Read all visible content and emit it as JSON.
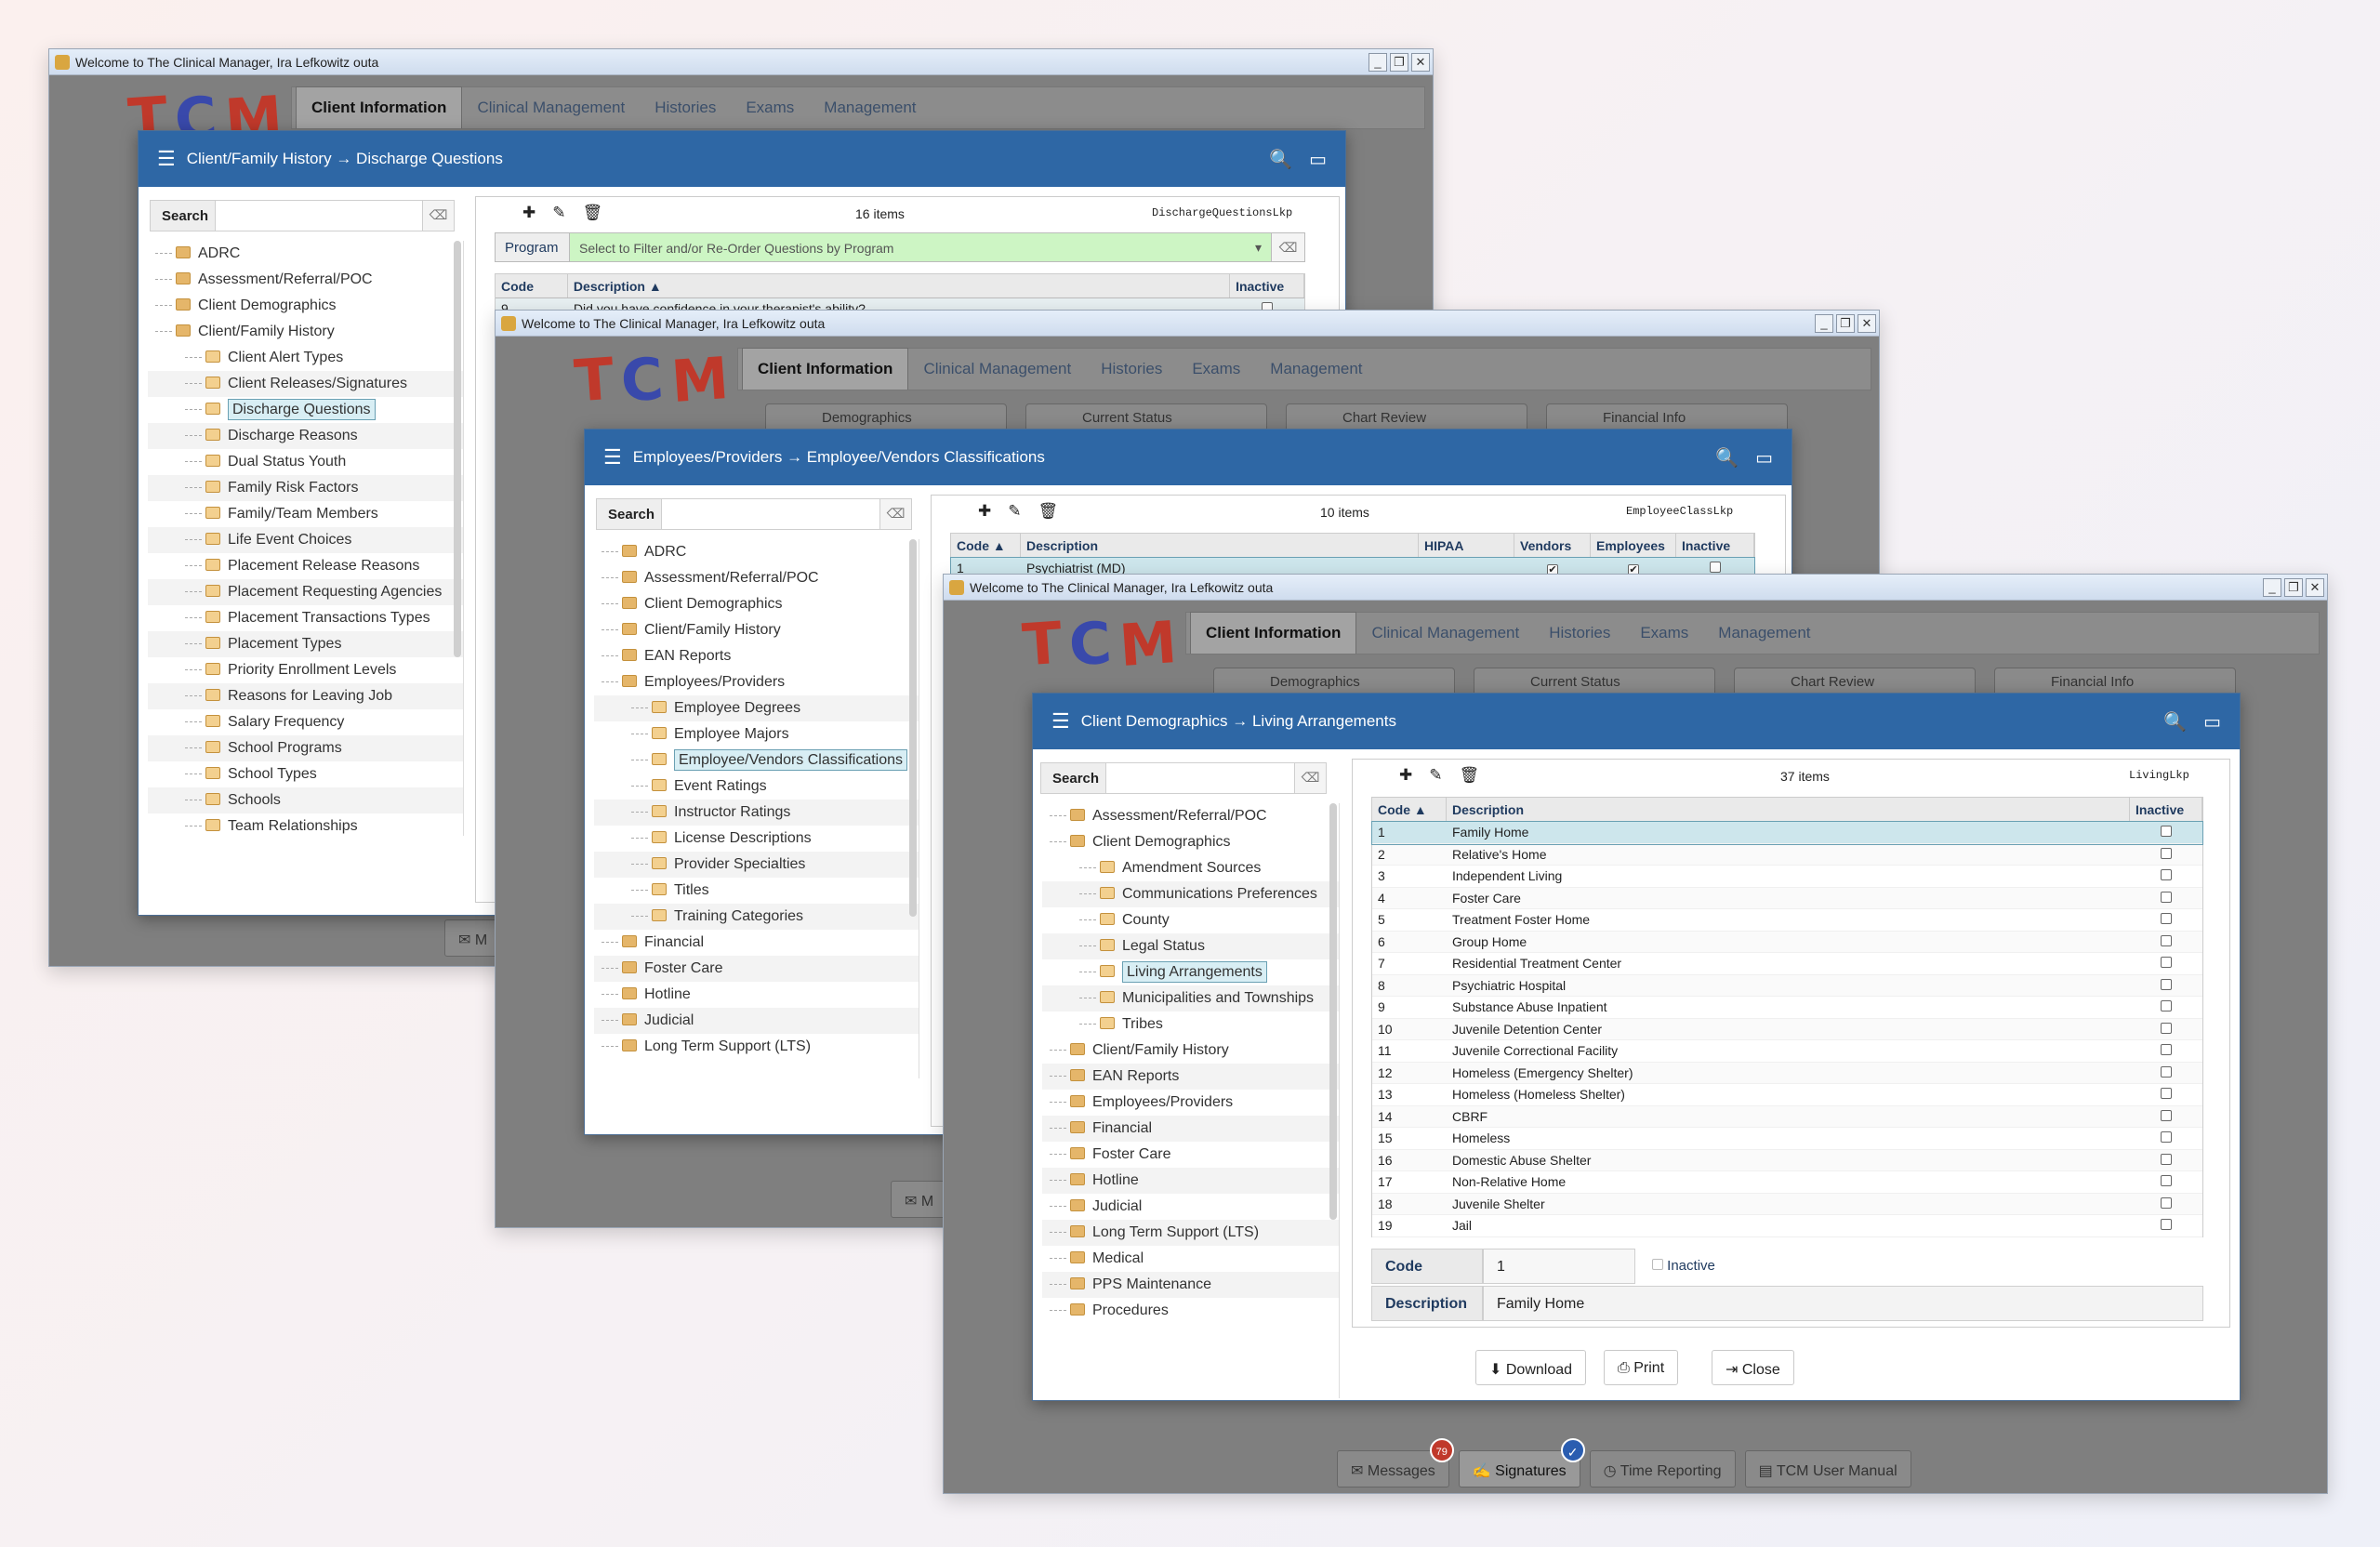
{
  "window_title": "Welcome to The Clinical Manager, Ira Lefkowitz outa",
  "logo": [
    "T",
    "C",
    "M"
  ],
  "colors": {
    "header_blue": "#2e67a5",
    "logo_t": "#c0392b",
    "logo_c": "#3949ab",
    "logo_m": "#c0392b",
    "filter_green": "#cdf5c4",
    "selection": "#cde6ec"
  },
  "nav_tabs": [
    "Client Information",
    "Clinical Management",
    "Histories",
    "Exams",
    "Management"
  ],
  "sub_tabs": [
    "Demographics",
    "Current Status",
    "Chart Review",
    "Financial Info"
  ],
  "bottom_bar": {
    "messages": "Messages",
    "messages_count": "79",
    "signatures": "Signatures",
    "time_reporting": "Time Reporting",
    "manual": "TCM User Manual",
    "short_msg": "M"
  },
  "search_label": "Search",
  "w1": {
    "modal_title": "Client/Family History → Discharge Questions",
    "count": "16 items",
    "lookup": "DischargeQuestionsLkp",
    "program_label": "Program",
    "program_placeholder": "Select to Filter and/or Re-Order Questions by Program",
    "headers": [
      "Code",
      "Description",
      "Inactive"
    ],
    "rows": [
      {
        "code": "9",
        "desc": "Did you have confidence in your therapist's ability?"
      }
    ],
    "tree": [
      "ADRC",
      "Assessment/Referral/POC",
      "Client Demographics",
      "Client/Family History",
      "Client Alert Types",
      "Client Releases/Signatures",
      "Discharge Questions",
      "Discharge Reasons",
      "Dual Status Youth",
      "Family Risk Factors",
      "Family/Team Members",
      "Life Event Choices",
      "Placement Release Reasons",
      "Placement Requesting Agencies",
      "Placement Transactions Types",
      "Placement Types",
      "Priority Enrollment Levels",
      "Reasons for Leaving Job",
      "Salary Frequency",
      "School Programs",
      "School Types",
      "Schools",
      "Team Relationships"
    ]
  },
  "w2": {
    "modal_title": "Employees/Providers → Employee/Vendors Classifications",
    "count": "10 items",
    "lookup": "EmployeeClassLkp",
    "headers": [
      "Code",
      "Description",
      "HIPAA",
      "Vendors",
      "Employees",
      "Inactive"
    ],
    "rows": [
      {
        "code": "1",
        "desc": "Psychiatrist (MD)"
      }
    ],
    "tree": [
      "ADRC",
      "Assessment/Referral/POC",
      "Client Demographics",
      "Client/Family History",
      "EAN Reports",
      "Employees/Providers",
      "Employee Degrees",
      "Employee Majors",
      "Employee/Vendors Classifications",
      "Event Ratings",
      "Instructor Ratings",
      "License Descriptions",
      "Provider Specialties",
      "Titles",
      "Training Categories",
      "Financial",
      "Foster Care",
      "Hotline",
      "Judicial",
      "Long Term Support (LTS)"
    ]
  },
  "w3": {
    "modal_title": "Client Demographics → Living Arrangements",
    "count": "37 items",
    "lookup": "LivingLkp",
    "headers": [
      "Code",
      "Description",
      "Inactive"
    ],
    "rows": [
      {
        "code": "1",
        "desc": "Family Home"
      },
      {
        "code": "2",
        "desc": "Relative's Home"
      },
      {
        "code": "3",
        "desc": "Independent Living"
      },
      {
        "code": "4",
        "desc": "Foster Care"
      },
      {
        "code": "5",
        "desc": "Treatment Foster Home"
      },
      {
        "code": "6",
        "desc": "Group Home"
      },
      {
        "code": "7",
        "desc": "Residential Treatment Center"
      },
      {
        "code": "8",
        "desc": "Psychiatric Hospital"
      },
      {
        "code": "9",
        "desc": "Substance Abuse Inpatient"
      },
      {
        "code": "10",
        "desc": "Juvenile Detention Center"
      },
      {
        "code": "11",
        "desc": "Juvenile Correctional Facility"
      },
      {
        "code": "12",
        "desc": "Homeless (Emergency Shelter)"
      },
      {
        "code": "13",
        "desc": "Homeless (Homeless Shelter)"
      },
      {
        "code": "14",
        "desc": "CBRF"
      },
      {
        "code": "15",
        "desc": "Homeless"
      },
      {
        "code": "16",
        "desc": "Domestic Abuse Shelter"
      },
      {
        "code": "17",
        "desc": "Non-Relative Home"
      },
      {
        "code": "18",
        "desc": "Juvenile Shelter"
      },
      {
        "code": "19",
        "desc": "Jail"
      }
    ],
    "tree": [
      "Assessment/Referral/POC",
      "Client Demographics",
      "Amendment Sources",
      "Communications Preferences",
      "County",
      "Legal Status",
      "Living Arrangements",
      "Municipalities and Townships",
      "Tribes",
      "Client/Family History",
      "EAN Reports",
      "Employees/Providers",
      "Financial",
      "Foster Care",
      "Hotline",
      "Judicial",
      "Long Term Support (LTS)",
      "Medical",
      "PPS Maintenance",
      "Procedures"
    ],
    "form": {
      "code_label": "Code",
      "code_value": "1",
      "inactive_label": "Inactive",
      "desc_label": "Description",
      "desc_value": "Family Home"
    },
    "buttons": {
      "download": "Download",
      "print": "Print",
      "close": "Close"
    }
  }
}
